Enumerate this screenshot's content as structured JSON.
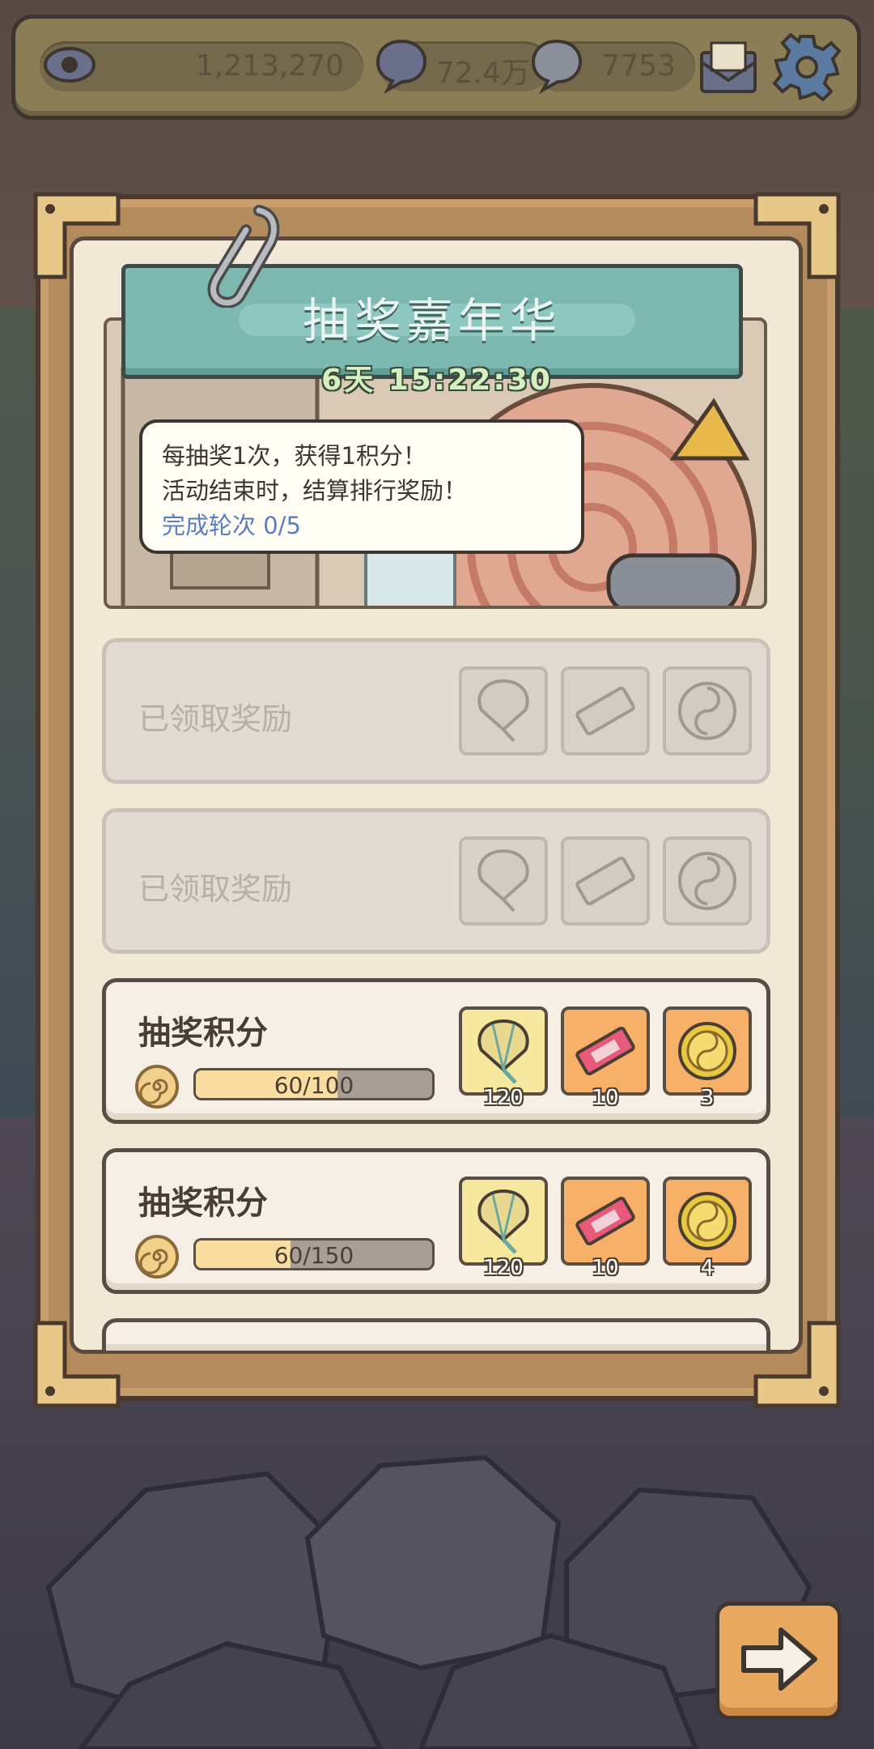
{
  "topbar": {
    "views": "1,213,270",
    "comments": "72.4万",
    "messages": "7753",
    "icons": [
      "eye-icon",
      "speech-bubble-icon",
      "chat-bubble-icon",
      "mail-icon",
      "gear-icon"
    ]
  },
  "event": {
    "title": "抽奖嘉年华",
    "timer": "6天 15:22:30",
    "info_line1": "每抽奖1次，获得1积分！",
    "info_line2": "活动结束时，结算排行奖励！",
    "progress_label": "完成轮次",
    "progress_value": "0/5"
  },
  "rewards": [
    {
      "state": "claimed",
      "label": "已领取奖励",
      "items": [
        {
          "icon": "hot-air-balloon-icon",
          "qty": ""
        },
        {
          "icon": "ticket-icon",
          "qty": ""
        },
        {
          "icon": "yin-yang-coin-icon",
          "qty": ""
        }
      ]
    },
    {
      "state": "claimed",
      "label": "已领取奖励",
      "items": [
        {
          "icon": "hot-air-balloon-icon",
          "qty": ""
        },
        {
          "icon": "ticket-icon",
          "qty": ""
        },
        {
          "icon": "yin-yang-coin-icon",
          "qty": ""
        }
      ]
    },
    {
      "state": "active",
      "label": "抽奖积分",
      "progress_text": "60/100",
      "progress": 0.6,
      "items": [
        {
          "icon": "hot-air-balloon-icon",
          "qty": "120"
        },
        {
          "icon": "ticket-icon",
          "qty": "10"
        },
        {
          "icon": "yin-yang-coin-icon",
          "qty": "3"
        }
      ]
    },
    {
      "state": "active",
      "label": "抽奖积分",
      "progress_text": "60/150",
      "progress": 0.4,
      "items": [
        {
          "icon": "hot-air-balloon-icon",
          "qty": "120"
        },
        {
          "icon": "ticket-icon",
          "qty": "10"
        },
        {
          "icon": "yin-yang-coin-icon",
          "qty": "4"
        }
      ]
    }
  ],
  "colors": {
    "banner": "#7cb8b0",
    "paper": "#f2e8d6",
    "slot_yellow": "#f7e8a0",
    "slot_orange": "#f6b068",
    "progress_fill": "#f8dca0"
  }
}
